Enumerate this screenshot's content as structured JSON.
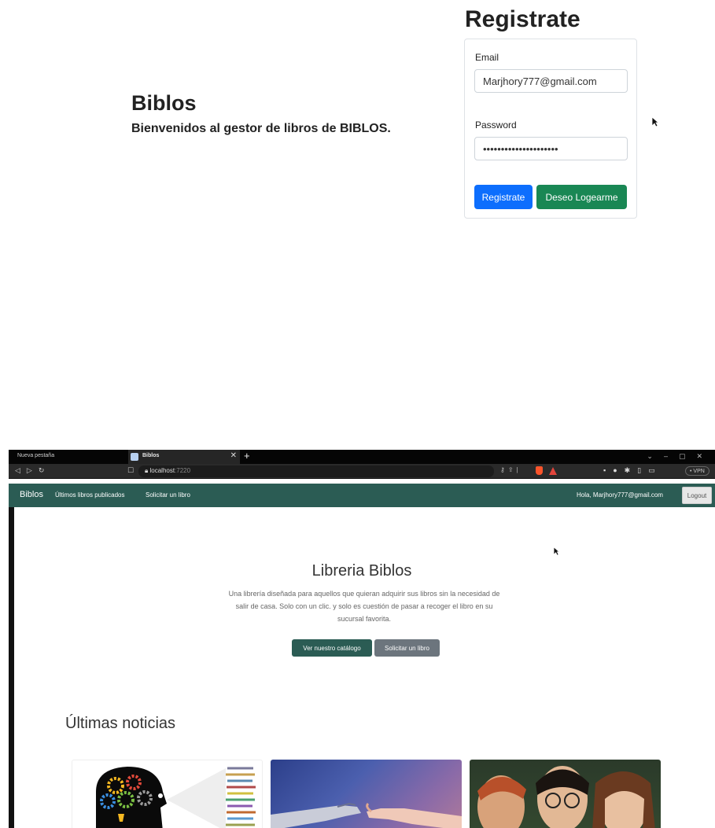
{
  "register": {
    "heading": "Registrate",
    "email_label": "Email",
    "email_value": "Marjhory777@gmail.com",
    "password_label": "Password",
    "password_value": "•••••••••••••••••••••",
    "register_button": "Registrate",
    "login_button": "Deseo Logearme"
  },
  "intro": {
    "title": "Biblos",
    "subtitle": "Bienvenidos al gestor de libros de BIBLOS."
  },
  "browser": {
    "tabs": [
      {
        "label": "Nueva pestaña"
      },
      {
        "label": "Biblos"
      }
    ],
    "url_host": "localhost",
    "url_port": ":7220",
    "vpn_label": "• VPN"
  },
  "site": {
    "brand": "Biblos",
    "nav_links": [
      "Últimos libros publicados",
      "Solicitar un libro"
    ],
    "greeting": "Hola, Marjhory777@gmail.com",
    "logout": "Logout",
    "hero_title": "Libreria Biblos",
    "hero_desc": "Una librería diseñada para aquellos que quieran adquirir sus libros sin la necesidad de salir de casa. Solo con un clic. y solo es cuestión de pasar a recoger el libro en su sucursal favorita.",
    "btn_catalog": "Ver nuestro catálogo",
    "btn_request": "Solicitar un libro",
    "news_title": "Últimas noticias"
  },
  "colors": {
    "primary": "#0d6efd",
    "success": "#198754",
    "site_accent": "#2b5c54",
    "secondary": "#6c757d"
  }
}
